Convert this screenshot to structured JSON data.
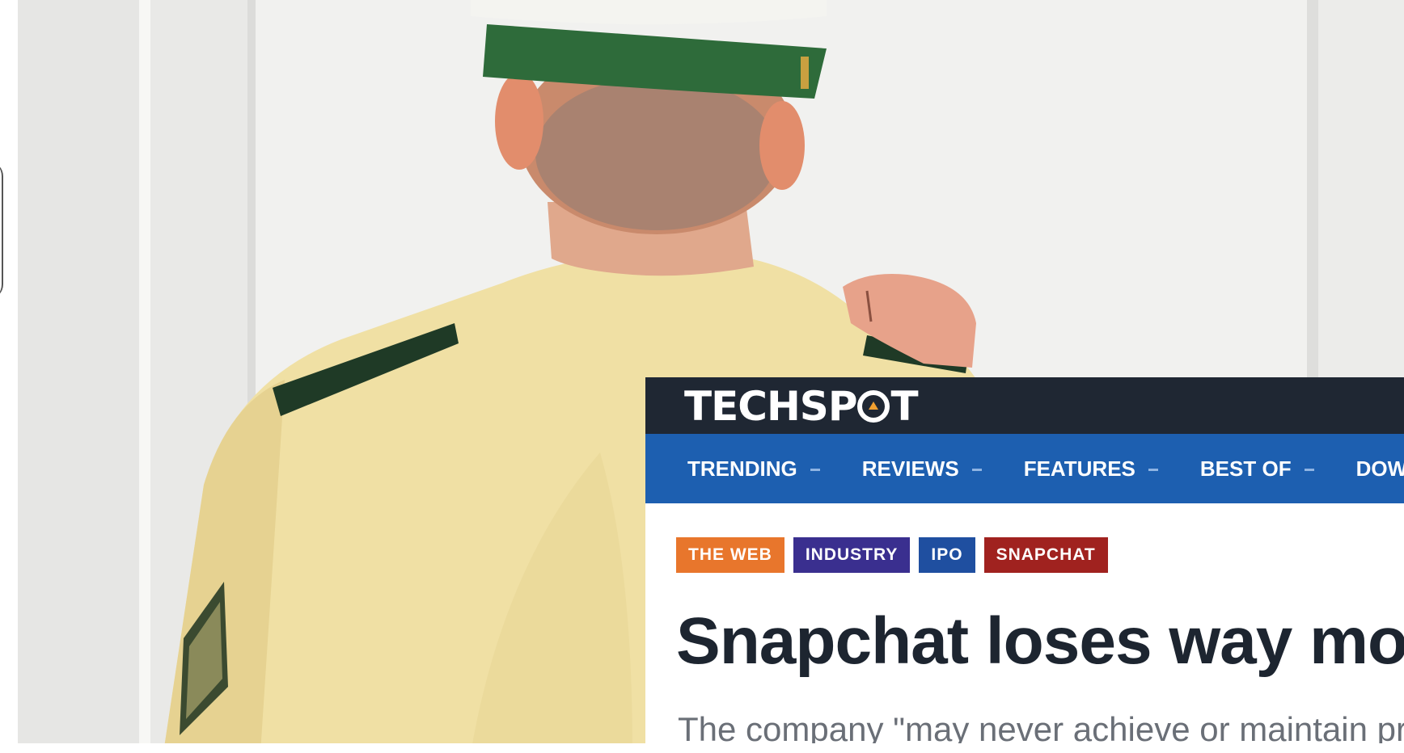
{
  "site": {
    "logo_text_left": "TECHSP",
    "logo_text_right": "T",
    "logo_accent": "#f0a030",
    "header_color": "#1f2733",
    "nav_color": "#1d5fb0"
  },
  "nav": {
    "items": [
      {
        "label": "TRENDING"
      },
      {
        "label": "REVIEWS"
      },
      {
        "label": "FEATURES"
      },
      {
        "label": "BEST OF"
      },
      {
        "label": "DOWN"
      }
    ]
  },
  "tags": [
    {
      "label": "THE WEB",
      "color": "#e8762c"
    },
    {
      "label": "INDUSTRY",
      "color": "#3a2f8f"
    },
    {
      "label": "IPO",
      "color": "#1f4fa0"
    },
    {
      "label": "SNAPCHAT",
      "color": "#a0221f"
    }
  ],
  "article": {
    "headline": "Snapchat loses way mo",
    "subheadline": "The company \"may never achieve or maintain pr"
  },
  "photo": {
    "subject": "uniformed-officer-knocking-door-icon",
    "shirt_color": "#f0e0a4",
    "cap_band_color": "#2e6b3a"
  }
}
